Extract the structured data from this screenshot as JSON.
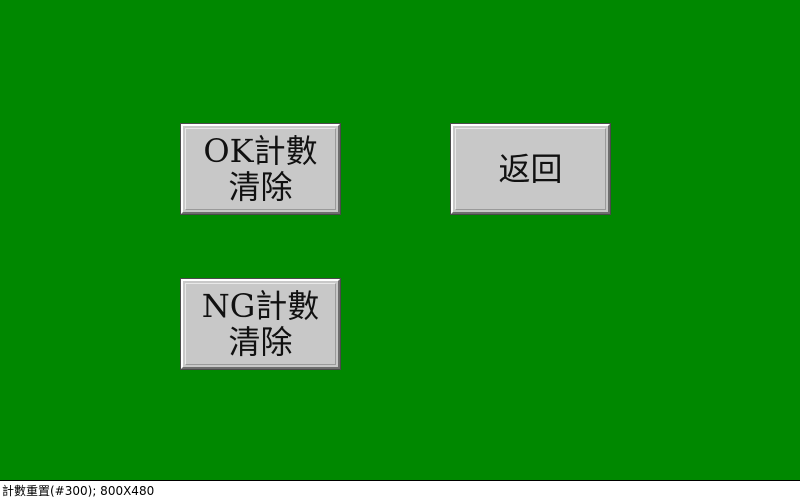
{
  "screen": {
    "background_color": "#008800"
  },
  "buttons": {
    "ok_reset_label": "OK計數\n清除",
    "back_label": "返回",
    "ng_reset_label": "NG計數\n清除",
    "face_color": "#c8c8c8"
  },
  "status_bar": {
    "text": "計數重置(#300); 800X480"
  }
}
